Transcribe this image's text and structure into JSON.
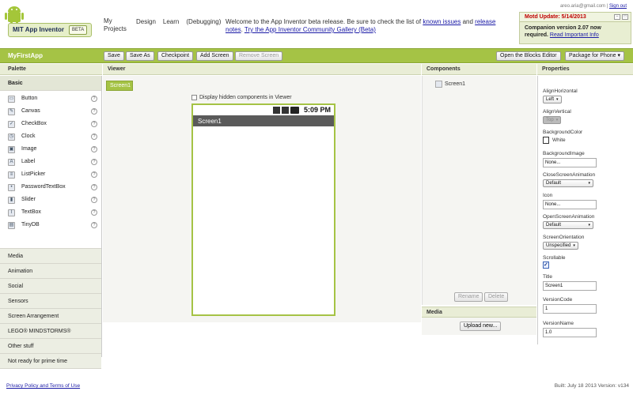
{
  "branding": {
    "app_name": "MIT App Inventor",
    "beta_badge": "BETA"
  },
  "topnav": {
    "projects": "My Projects",
    "design": "Design",
    "learn": "Learn",
    "debugging": "(Debugging)"
  },
  "welcome": {
    "text1": "Welcome to the App Inventor beta release. Be sure to check the list of ",
    "link1": "known issues",
    "text2": " and ",
    "link2": "release notes",
    "text3": ". ",
    "link3": "Try the App Inventor Community Gallery (Beta)"
  },
  "account": {
    "email": "areo.aria@gmail.com",
    "separator": "|",
    "signout": "Sign out"
  },
  "motd": {
    "title": "Motd Update: 5/14/2013",
    "body": "Companion version 2.07 now required. ",
    "link": "Read Important Info"
  },
  "toolbar": {
    "project_name": "MyFirstApp",
    "save": "Save",
    "save_as": "Save As",
    "checkpoint": "Checkpoint",
    "add_screen": "Add Screen",
    "remove_screen": "Remove Screen",
    "open_blocks": "Open the Blocks Editor",
    "package": "Package for Phone"
  },
  "columns": {
    "palette": "Palette",
    "viewer": "Viewer",
    "components": "Components",
    "properties": "Properties"
  },
  "palette": {
    "basic_label": "Basic",
    "basic_items": [
      {
        "label": "Button",
        "icon": "button-icon",
        "glyph": "▭"
      },
      {
        "label": "Canvas",
        "icon": "canvas-icon",
        "glyph": "✎"
      },
      {
        "label": "CheckBox",
        "icon": "checkbox-icon",
        "glyph": "✓"
      },
      {
        "label": "Clock",
        "icon": "clock-icon",
        "glyph": "◷"
      },
      {
        "label": "Image",
        "icon": "image-icon",
        "glyph": "▣"
      },
      {
        "label": "Label",
        "icon": "label-icon",
        "glyph": "A"
      },
      {
        "label": "ListPicker",
        "icon": "listpicker-icon",
        "glyph": "≡"
      },
      {
        "label": "PasswordTextBox",
        "icon": "password-icon",
        "glyph": "•"
      },
      {
        "label": "Slider",
        "icon": "slider-icon",
        "glyph": "▮"
      },
      {
        "label": "TextBox",
        "icon": "textbox-icon",
        "glyph": "I"
      },
      {
        "label": "TinyDB",
        "icon": "tinydb-icon",
        "glyph": "▤"
      }
    ],
    "help_glyph": "?",
    "categories": [
      "Media",
      "Animation",
      "Social",
      "Sensors",
      "Screen Arrangement",
      "LEGO® MINDSTORMS®",
      "Other stuff",
      "Not ready for prime time"
    ]
  },
  "viewer": {
    "screen_tab": "Screen1",
    "hidden_components": "Display hidden components in Viewer",
    "phone_time": "5:09 PM",
    "phone_title": "Screen1"
  },
  "components": {
    "root": "Screen1",
    "rename": "Rename",
    "delete": "Delete",
    "media_label": "Media",
    "upload": "Upload new..."
  },
  "properties": {
    "align_horizontal": {
      "label": "AlignHorizontal",
      "value": "Left"
    },
    "align_vertical": {
      "label": "AlignVertical",
      "value": "Top"
    },
    "background_color": {
      "label": "BackgroundColor",
      "value": "White"
    },
    "background_image": {
      "label": "BackgroundImage",
      "value": "None..."
    },
    "close_screen_animation": {
      "label": "CloseScreenAnimation",
      "value": "Default"
    },
    "icon": {
      "label": "Icon",
      "value": "None..."
    },
    "open_screen_animation": {
      "label": "OpenScreenAnimation",
      "value": "Default"
    },
    "screen_orientation": {
      "label": "ScreenOrientation",
      "value": "Unspecified"
    },
    "scrollable": {
      "label": "Scrollable",
      "checked": true
    },
    "title": {
      "label": "Title",
      "value": "Screen1"
    },
    "version_code": {
      "label": "VersionCode",
      "value": "1"
    },
    "version_name": {
      "label": "VersionName",
      "value": "1.0"
    }
  },
  "footer": {
    "privacy": "Privacy Policy and Terms of Use",
    "build": "Built: July 18 2013 Version: v134"
  },
  "colors": {
    "accent_green": "#a5c345",
    "motd_title": "#c00000",
    "link_blue": "#1a1aa6"
  }
}
